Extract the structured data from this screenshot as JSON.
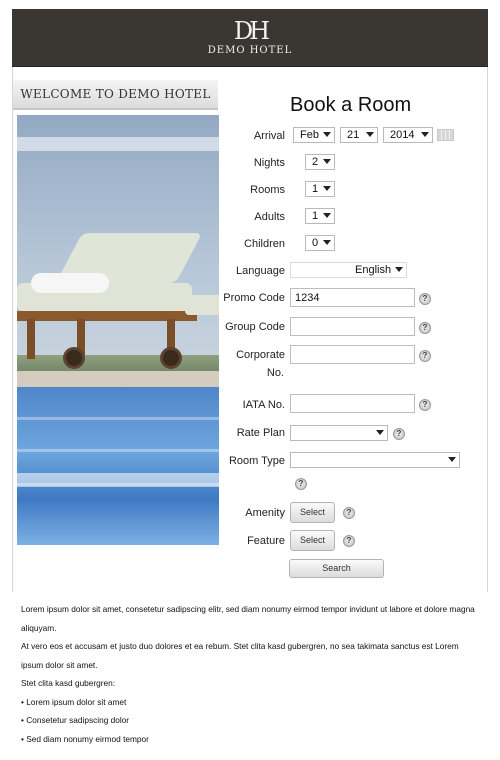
{
  "brand": {
    "mark": "DH",
    "name": "DEMO HOTEL"
  },
  "welcome": "WELCOME TO DEMO HOTEL",
  "form": {
    "title": "Book a Room",
    "arrival": {
      "label": "Arrival",
      "month": "Feb",
      "day": "21",
      "year": "2014"
    },
    "nights": {
      "label": "Nights",
      "value": "2"
    },
    "rooms": {
      "label": "Rooms",
      "value": "1"
    },
    "adults": {
      "label": "Adults",
      "value": "1"
    },
    "children": {
      "label": "Children",
      "value": "0"
    },
    "language": {
      "label": "Language",
      "value": "English"
    },
    "promo_code": {
      "label": "Promo Code",
      "value": "1234"
    },
    "group_code": {
      "label": "Group Code",
      "value": ""
    },
    "corporate_no": {
      "label_line1": "Corporate",
      "label_line2": "No.",
      "value": ""
    },
    "iata_no": {
      "label": "IATA No.",
      "value": ""
    },
    "rate_plan": {
      "label": "Rate Plan",
      "value": ""
    },
    "room_type": {
      "label": "Room Type",
      "value": ""
    },
    "amenity": {
      "label": "Amenity",
      "button": "Select"
    },
    "feature": {
      "label": "Feature",
      "button": "Select"
    },
    "search_button": "Search",
    "help_glyph": "?"
  },
  "content": {
    "paragraph1": "Lorem ipsum dolor sit amet, consetetur sadipscing elitr, sed diam nonumy eirmod tempor invidunt ut labore et dolore magna aliquyam.",
    "paragraph2": "At vero eos et accusam et justo duo dolores et ea rebum. Stet clita kasd gubergren, no sea takimata sanctus est Lorem ipsum dolor sit amet.",
    "list_intro": "Stet clita kasd gubergren:",
    "bullets": [
      "Lorem ipsum dolor sit amet",
      "Consetetur sadipscing dolor",
      "Sed diam nonumy eirmod tempor"
    ]
  },
  "colors": {
    "header_bg": "#3a3733",
    "header_text": "#f2f2f2"
  },
  "icons": [
    "calendar-icon",
    "help-icon",
    "dropdown-arrow-icon"
  ]
}
